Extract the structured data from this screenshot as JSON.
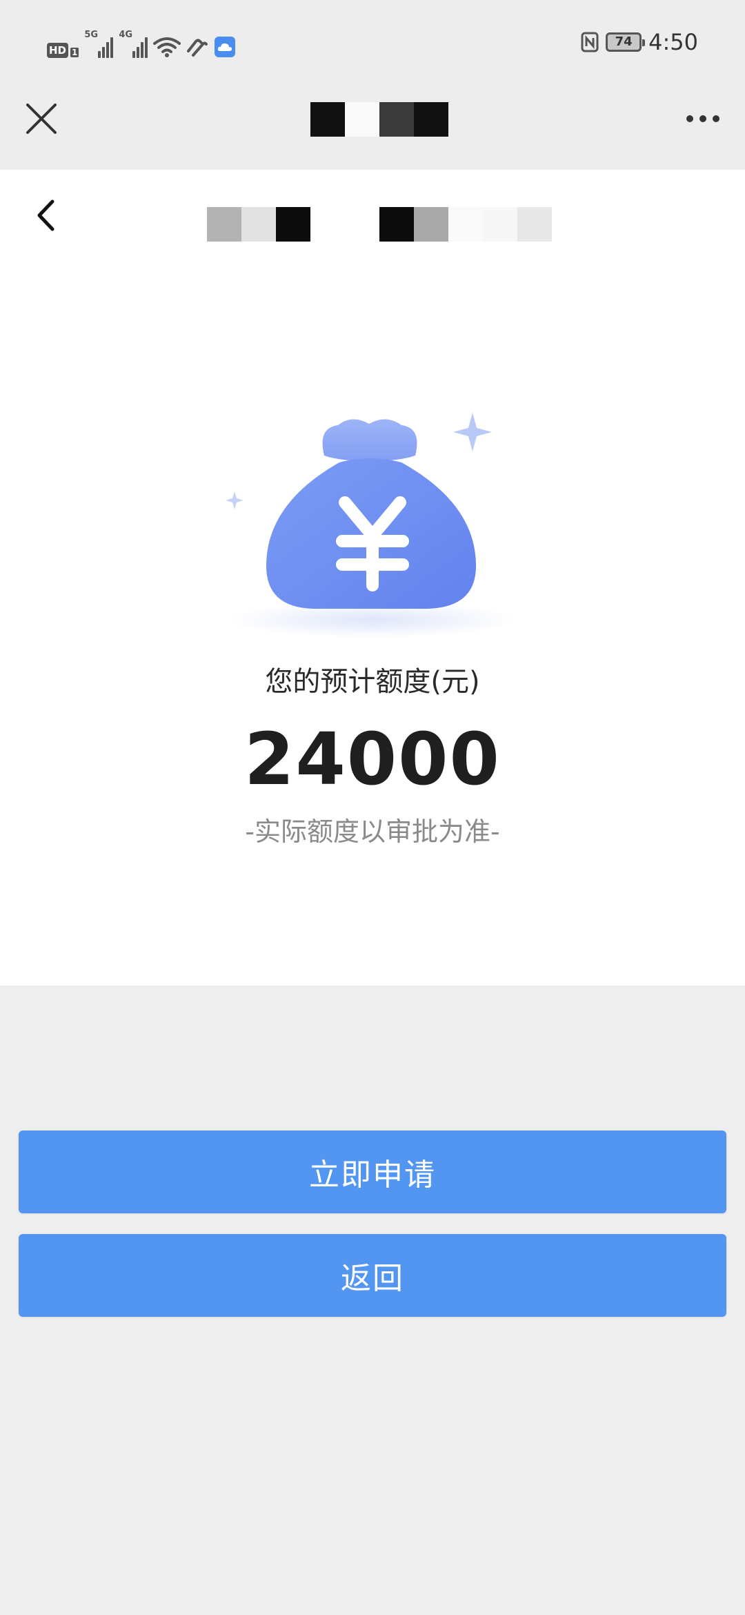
{
  "status_bar": {
    "hd_label": "HD",
    "sim_slot": "1",
    "net1_label": "5G",
    "net2_label": "4G",
    "battery_level": "74",
    "time": "4:50",
    "icons": [
      "hd-icon",
      "signal-5g-icon",
      "signal-4g-icon",
      "wifi-icon",
      "hands-icon",
      "cloud-icon",
      "nfc-icon",
      "battery-icon"
    ]
  },
  "navbar": {
    "close_icon": "close-icon",
    "more_icon": "more-icon"
  },
  "page": {
    "back_icon": "chevron-left-icon",
    "illustration_icon": "money-bag-yen-icon",
    "estimate_label": "您的预计额度(元)",
    "amount": "24000",
    "note": "-实际额度以审批为准-"
  },
  "actions": {
    "apply_label": "立即申请",
    "back_label": "返回"
  },
  "colors": {
    "accent": "#5296f2",
    "bag": "#6f8ff0",
    "background": "#eeeeef",
    "card": "#ffffff"
  }
}
